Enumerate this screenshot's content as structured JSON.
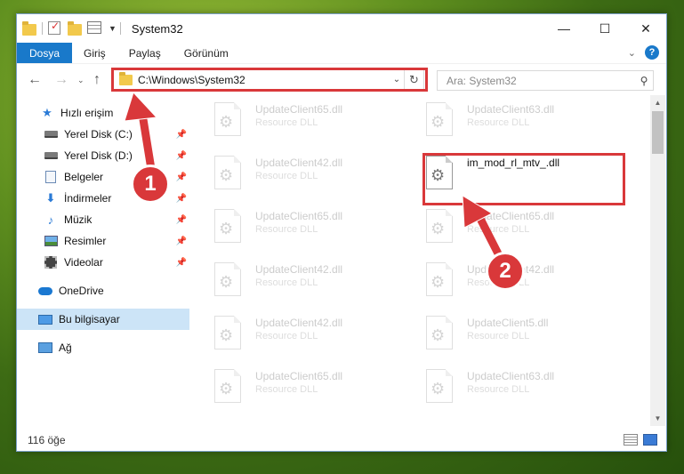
{
  "window": {
    "title": "System32",
    "controls": {
      "minimize": "—",
      "maximize": "☐",
      "close": "✕"
    }
  },
  "ribbon": {
    "tabs": [
      {
        "label": "Dosya",
        "active": true
      },
      {
        "label": "Giriş",
        "active": false
      },
      {
        "label": "Paylaş",
        "active": false
      },
      {
        "label": "Görünüm",
        "active": false
      }
    ],
    "help": "?"
  },
  "address_bar": {
    "path": "C:\\Windows\\System32",
    "search_placeholder": "Ara: System32"
  },
  "sidebar": {
    "items": [
      {
        "label": "Hızlı erişim",
        "icon": "star-icon",
        "pinned": false
      },
      {
        "label": "Yerel Disk (C:)",
        "icon": "drive-icon",
        "pinned": true
      },
      {
        "label": "Yerel Disk (D:)",
        "icon": "drive-icon",
        "pinned": true
      },
      {
        "label": "Belgeler",
        "icon": "documents-icon",
        "pinned": true
      },
      {
        "label": "İndirmeler",
        "icon": "downloads-icon",
        "pinned": true
      },
      {
        "label": "Müzik",
        "icon": "music-icon",
        "pinned": true
      },
      {
        "label": "Resimler",
        "icon": "pictures-icon",
        "pinned": true
      },
      {
        "label": "Videolar",
        "icon": "videos-icon",
        "pinned": true
      },
      {
        "label": "OneDrive",
        "icon": "onedrive-icon",
        "pinned": false
      },
      {
        "label": "Bu bilgisayar",
        "icon": "this-pc-icon",
        "pinned": false,
        "selected": true
      },
      {
        "label": "Ağ",
        "icon": "network-icon",
        "pinned": false
      }
    ]
  },
  "files": [
    {
      "name": "UpdateClient65.dll",
      "type": "Resource DLL",
      "faded": true
    },
    {
      "name": "UpdateClient63.dll",
      "type": "Resource DLL",
      "faded": true
    },
    {
      "name": "UpdateClient42.dll",
      "type": "Resource DLL",
      "faded": true
    },
    {
      "name": "im_mod_rl_mtv_.dll",
      "type": "",
      "faded": false
    },
    {
      "name": "UpdateClient65.dll",
      "type": "Resource DLL",
      "faded": true
    },
    {
      "name": "UpdateClient65.dll",
      "type": "Resource DLL",
      "faded": true
    },
    {
      "name": "UpdateClient42.dll",
      "type": "Resource DLL",
      "faded": true
    },
    {
      "name": "UpdateClient42.dll",
      "type": "Resource DLL",
      "faded": true
    },
    {
      "name": "UpdateClient42.dll",
      "type": "Resource DLL",
      "faded": true
    },
    {
      "name": "UpdateClient5.dll",
      "type": "Resource DLL",
      "faded": true
    },
    {
      "name": "UpdateClient65.dll",
      "type": "Resource DLL",
      "faded": true
    },
    {
      "name": "UpdateClient63.dll",
      "type": "Resource DLL",
      "faded": true
    }
  ],
  "status": {
    "item_count": "116 öğe"
  },
  "annotations": {
    "step1": "1",
    "step2": "2",
    "accent_color": "#d9383a"
  }
}
